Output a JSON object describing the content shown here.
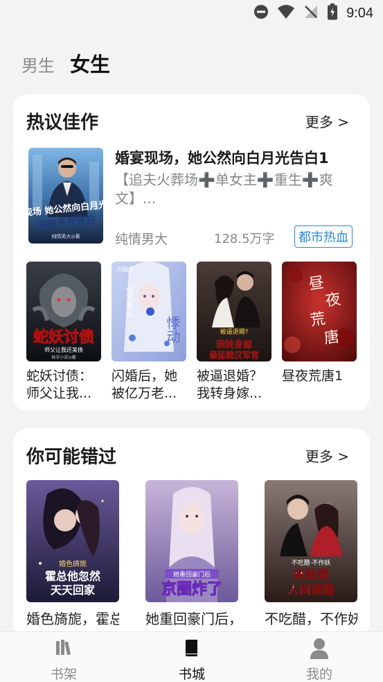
{
  "status_bar": {
    "time": "9:04"
  },
  "gender_tabs": [
    {
      "label": "男生",
      "active": false
    },
    {
      "label": "女生",
      "active": true
    }
  ],
  "hot_section": {
    "title": "热议佳作",
    "more": "更多 >",
    "featured": {
      "title": "婚宴现场，她公然向白月光告白1",
      "description": "【追夫火葬场➕单女主➕重生➕爽文】...",
      "author": "纯情男大",
      "word_count": "128.5万字",
      "tag": "都市热血",
      "cover_text": "婚宴现场 她公然向白月光告白",
      "cover_author": "纯情男大◎著"
    },
    "books": [
      {
        "name": "蛇妖讨债：师父让我...",
        "cover_text": "蛇妖讨债",
        "cover_sub": "师父让我还美债",
        "cover_author": "秋宇小说◎著"
      },
      {
        "name": "闪婚后，她被亿万老...",
        "cover_text": "悸动",
        "cover_sub": "亿万老公",
        "cover_corner": "闪婚后"
      },
      {
        "name": "被逼退婚？我转身嫁...",
        "cover_text": "我转身嫁最猛糙汉军官",
        "cover_sub": "被逼退婚?"
      },
      {
        "name": "昼夜荒唐1",
        "cover_text": "昼夜荒唐"
      }
    ]
  },
  "missed_section": {
    "title": "你可能错过",
    "more": "更多 >",
    "books": [
      {
        "name": "婚色旖旎，霍总他忽然天天回家",
        "cover_text": "霍总他忽然天天回家",
        "cover_sub": "婚色旖旎"
      },
      {
        "name": "她重回豪门后，京圈炸了",
        "cover_text": "京圈炸了",
        "cover_sub": "她重回豪门后"
      },
      {
        "name": "不吃醋，不作妖，林助理人间清醒",
        "cover_text": "林助理人间清醒",
        "cover_sub": "不吃醋·不作妖"
      }
    ]
  },
  "bottom_nav": [
    {
      "label": "书架",
      "icon": "bookshelf-icon",
      "active": false
    },
    {
      "label": "书城",
      "icon": "book-icon",
      "active": true
    },
    {
      "label": "我的",
      "icon": "person-icon",
      "active": false
    }
  ],
  "colors": {
    "background": "#f3f3f4",
    "card": "#ffffff",
    "tag_blue": "#2a86d8",
    "muted_text": "#888888"
  }
}
